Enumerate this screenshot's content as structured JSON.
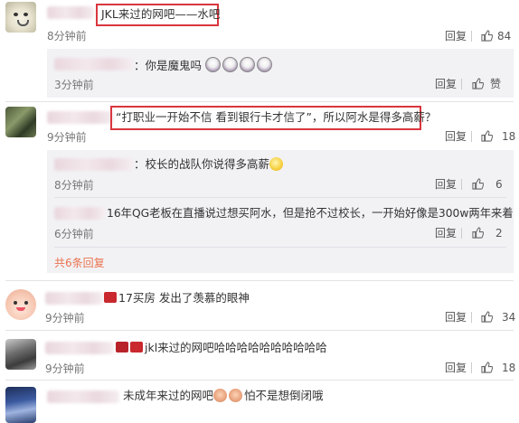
{
  "colors": {
    "highlight": "#d9363e",
    "link": "#eb7350",
    "panel": "#f2f2f5"
  },
  "comments": [
    {
      "text": "JKL来过的网吧——水吧",
      "time": "8分钟前",
      "reply": "回复",
      "likes": "84",
      "highlighted": true
    },
    {
      "text": "“打职业一开始不信 看到银行卡才信了”，所以阿水是得多高薪？",
      "time": "9分钟前",
      "reply": "回复",
      "likes": "18",
      "highlighted": true
    },
    {
      "text": "17买房 发出了羡慕的眼神",
      "time": "9分钟前",
      "reply": "回复",
      "likes": "34"
    },
    {
      "text": "jkl来过的网吧哈哈哈哈哈哈哈哈哈哈",
      "time": "9分钟前",
      "reply": "回复",
      "likes": "18"
    },
    {
      "text": "未成年来过的网吧",
      "text2": "怕不是想倒闭哦",
      "time": "",
      "reply": "",
      "likes": ""
    }
  ],
  "replies": [
    {
      "text": "：你是魔鬼吗",
      "time": "3分钟前",
      "reply": "回复",
      "likes": "赞"
    },
    {
      "text": "：校长的战队你说得多高薪",
      "time": "8分钟前",
      "reply": "回复",
      "likes": "6"
    },
    {
      "text": "16年QG老板在直播说过想买阿水，但是抢不过校长，一开始好像是300w两年来着",
      "time": "6分钟前",
      "reply": "回复",
      "likes": "2"
    }
  ],
  "more_replies": "共6条回复",
  "icons": [
    "thumb-up-icon",
    "reply-icon",
    "emoji-icon",
    "badge-icon"
  ]
}
